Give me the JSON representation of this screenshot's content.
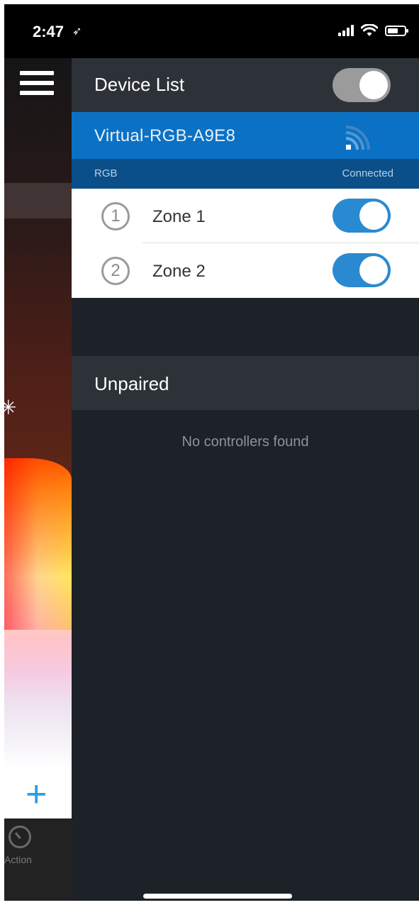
{
  "status_bar": {
    "time": "2:47",
    "location_icon": "location-arrow-icon",
    "signal_icon": "cellular-signal-icon",
    "wifi_icon": "wifi-icon",
    "battery_icon": "battery-icon"
  },
  "background_app": {
    "menu_icon": "hamburger-menu-icon",
    "brightness_icon": "sun-icon",
    "add_icon": "plus-icon",
    "add_icon_color": "#2a9fe0",
    "action_icon": "timer-icon",
    "action_label": "Action"
  },
  "drawer": {
    "title": "Device List",
    "master_toggle_on": true,
    "device": {
      "name": "Virtual-RGB-A9E8",
      "type": "RGB",
      "status": "Connected",
      "signal_icon": "wifi-signal-icon",
      "accent_color": "#0b71c4",
      "zones": [
        {
          "number": "1",
          "name": "Zone 1",
          "enabled": true
        },
        {
          "number": "2",
          "name": "Zone 2",
          "enabled": true
        }
      ]
    },
    "unpaired": {
      "title": "Unpaired",
      "empty_message": "No controllers found"
    }
  }
}
